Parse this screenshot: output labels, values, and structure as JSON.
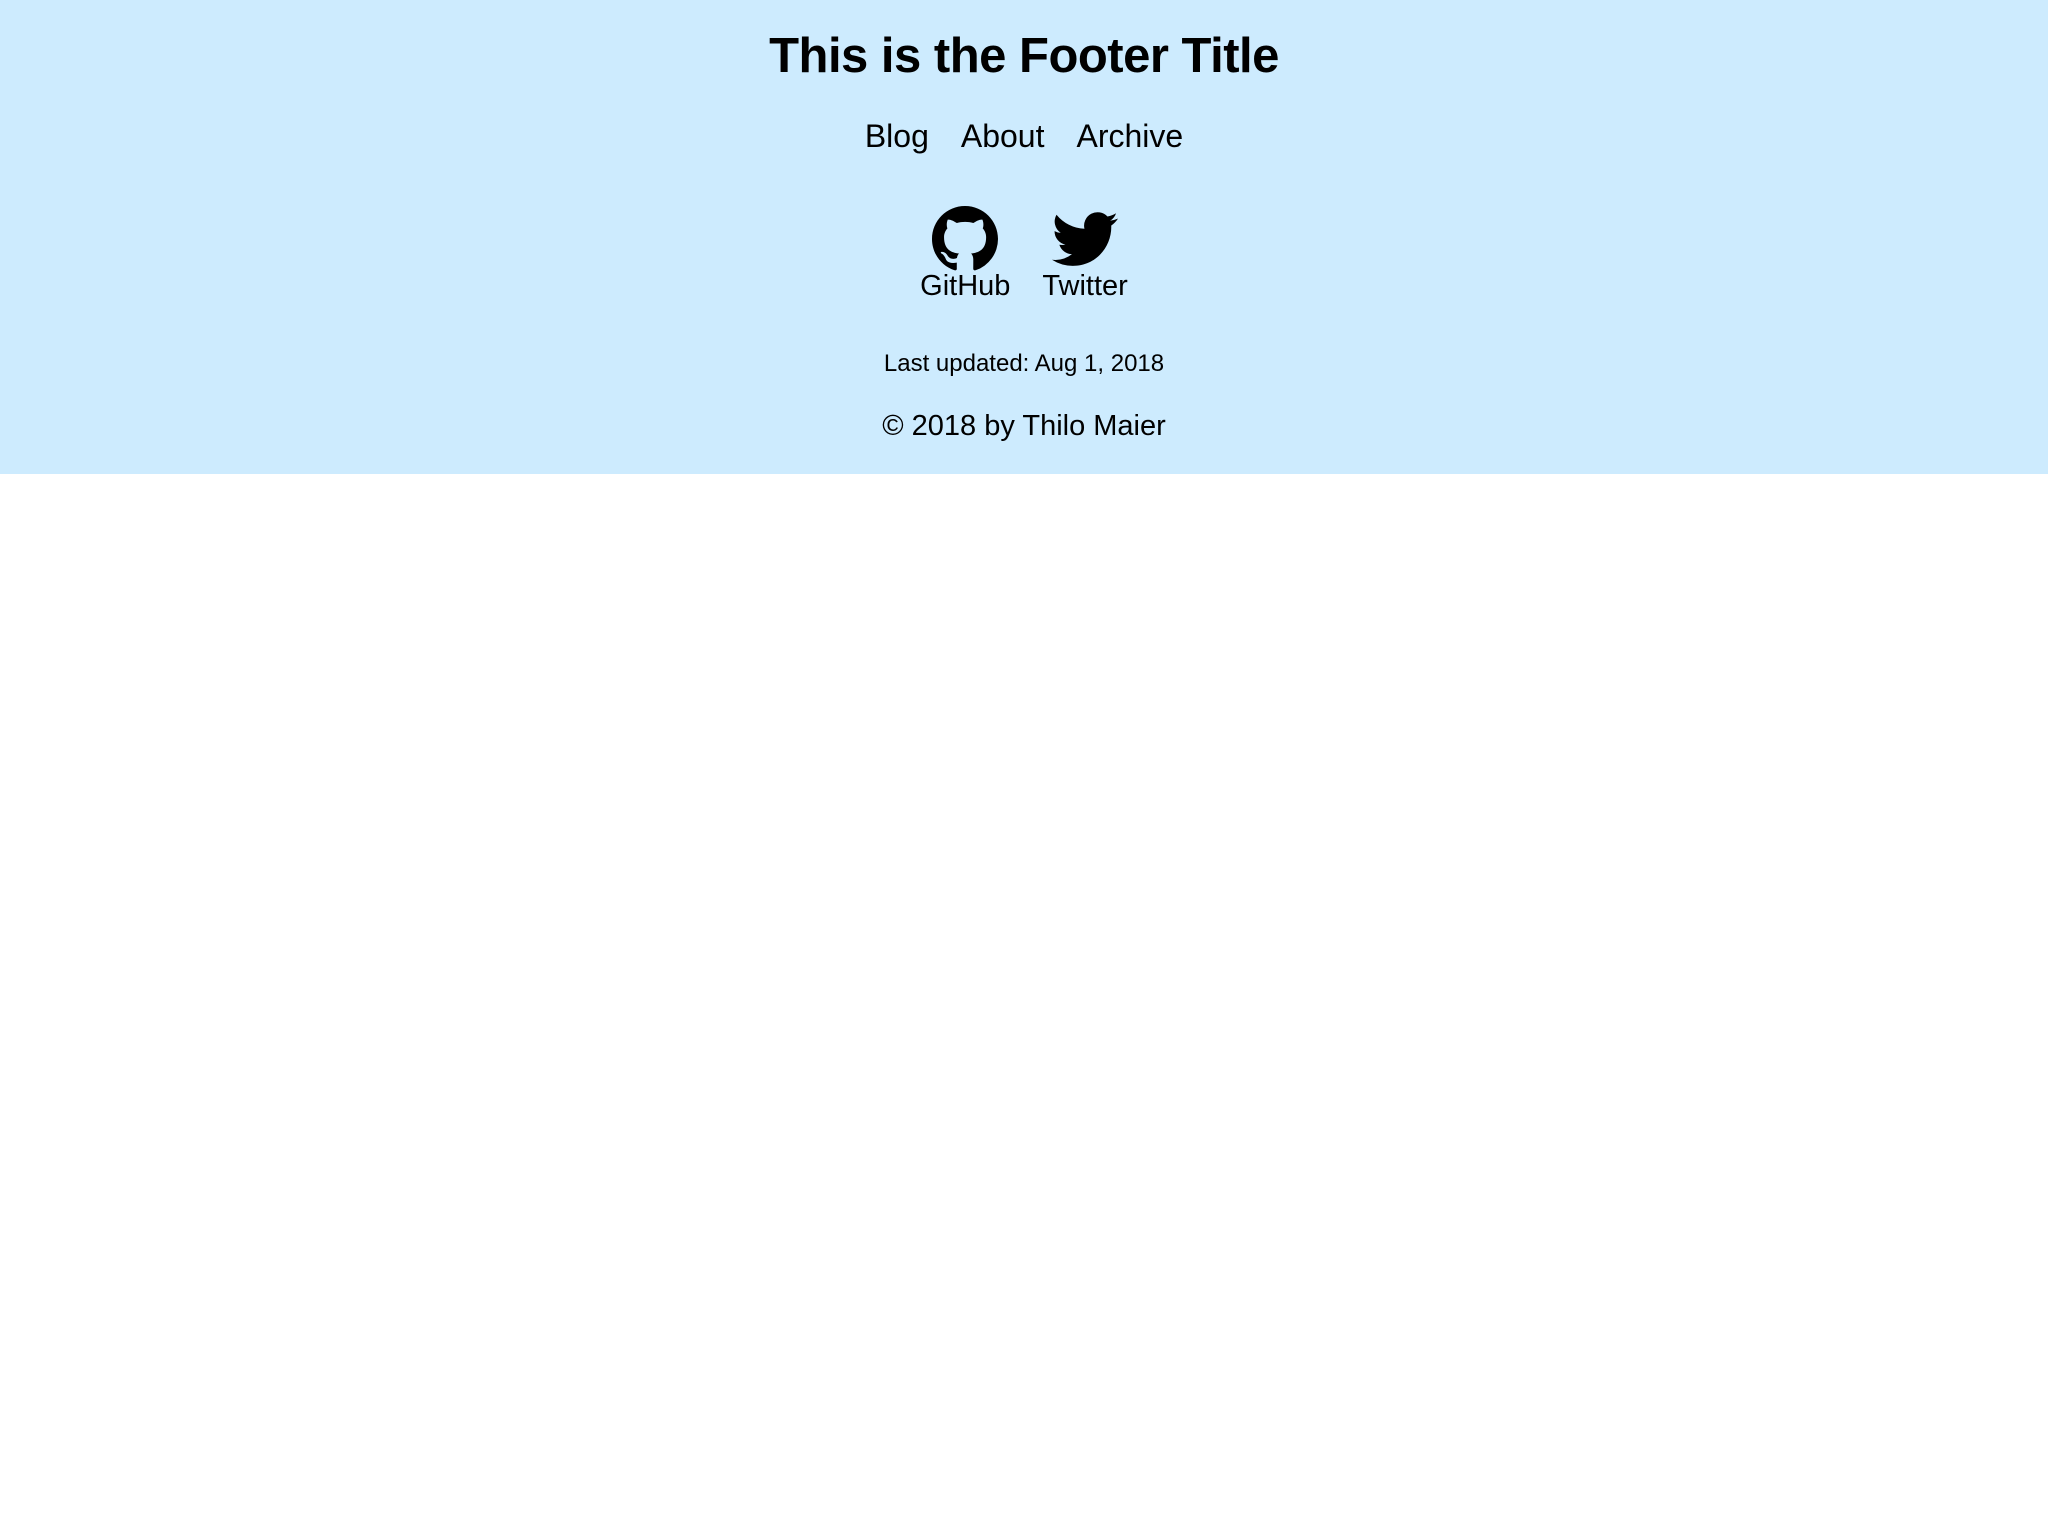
{
  "footer": {
    "title": "This is the Footer Title",
    "background_color": "#cdebfe",
    "nav": [
      {
        "label": "Blog"
      },
      {
        "label": "About"
      },
      {
        "label": "Archive"
      }
    ],
    "social": [
      {
        "label": "GitHub",
        "icon": "github-icon"
      },
      {
        "label": "Twitter",
        "icon": "twitter-icon"
      }
    ],
    "last_updated": "Last updated: Aug 1, 2018",
    "copyright": "© 2018 by Thilo Maier"
  }
}
